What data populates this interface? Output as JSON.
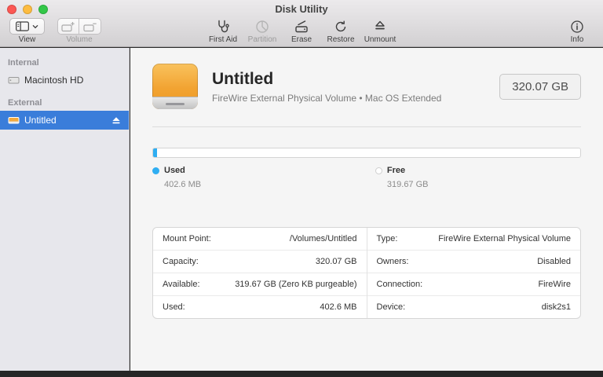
{
  "window": {
    "title": "Disk Utility"
  },
  "toolbar": {
    "view": {
      "label": "View"
    },
    "volume": {
      "label": "Volume"
    },
    "buttons": [
      {
        "label": "First Aid"
      },
      {
        "label": "Partition"
      },
      {
        "label": "Erase"
      },
      {
        "label": "Restore"
      },
      {
        "label": "Unmount"
      }
    ],
    "info": {
      "label": "Info"
    }
  },
  "sidebar": {
    "sections": [
      {
        "header": "Internal",
        "items": [
          {
            "label": "Macintosh HD"
          }
        ]
      },
      {
        "header": "External",
        "items": [
          {
            "label": "Untitled"
          }
        ]
      }
    ]
  },
  "main": {
    "header": {
      "title": "Untitled",
      "subtitle": "FireWire External Physical Volume • Mac OS Extended",
      "capacity": "320.07 GB"
    },
    "usage": {
      "used_label": "Used",
      "used_value": "402.6 MB",
      "free_label": "Free",
      "free_value": "319.67 GB",
      "used_percent": 0.13,
      "used_color": "#2faef2"
    },
    "details": {
      "left": [
        {
          "label": "Mount Point:",
          "value": "/Volumes/Untitled"
        },
        {
          "label": "Capacity:",
          "value": "320.07 GB"
        },
        {
          "label": "Available:",
          "value": "319.67 GB (Zero KB purgeable)"
        },
        {
          "label": "Used:",
          "value": "402.6 MB"
        }
      ],
      "right": [
        {
          "label": "Type:",
          "value": "FireWire External Physical Volume"
        },
        {
          "label": "Owners:",
          "value": "Disabled"
        },
        {
          "label": "Connection:",
          "value": "FireWire"
        },
        {
          "label": "Device:",
          "value": "disk2s1"
        }
      ]
    }
  }
}
